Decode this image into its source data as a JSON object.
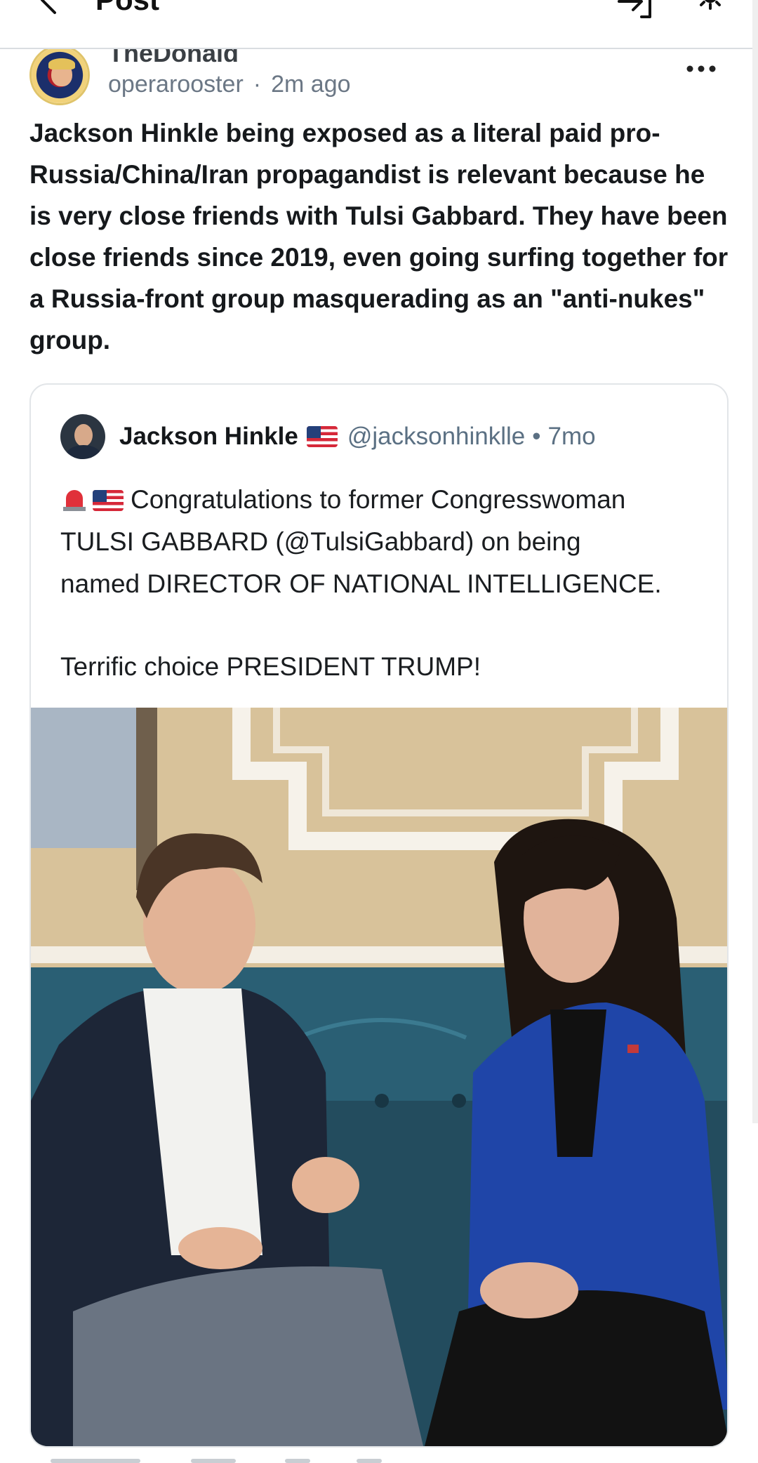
{
  "header": {
    "title": "Post",
    "back_icon": "back-arrow-icon",
    "share_icon": "share-exit-icon",
    "settings_icon": "gear-icon"
  },
  "post": {
    "community": "TheDonald",
    "author": "operarooster",
    "separator": "·",
    "time": "2m ago",
    "more_icon": "more-dots-icon",
    "body": "Jackson Hinkle being exposed as a literal paid pro-Russia/China/Iran propagandist is relevant because he is very close friends with Tulsi Gabbard. They have been close friends since 2019, even going surfing together for a Russia-front group masquerading as an \"anti-nukes\" group."
  },
  "quote": {
    "name": "Jackson Hinkle",
    "flag_icon": "us-flag-icon",
    "handle": "@jacksonhinklle",
    "separator": "•",
    "time": "7mo",
    "lines": [
      "Congratulations to former Congresswoman",
      "TULSI GABBARD (@TulsiGabbard) on being",
      "named DIRECTOR OF NATIONAL INTELLIGENCE."
    ],
    "closing": "Terrific choice PRESIDENT TRUMP!",
    "emoji_icons": [
      "siren-icon",
      "us-flag-icon"
    ]
  },
  "colors": {
    "text": "#14171a",
    "muted": "#6b7785",
    "border": "#e2e5e8",
    "blazer_blue": "#1f45a8",
    "couch_teal": "#2a5f74"
  }
}
